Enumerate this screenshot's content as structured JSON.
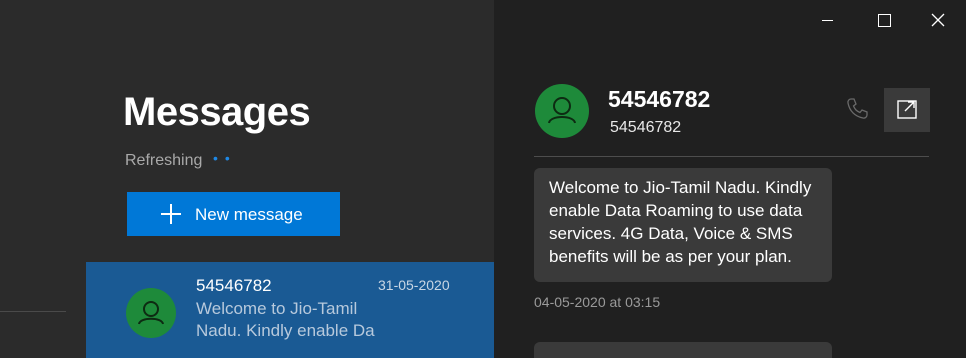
{
  "window": {
    "controls": [
      "minimize",
      "maximize",
      "close"
    ]
  },
  "sidebar": {
    "title": "Messages",
    "status": "Refreshing",
    "new_message_label": "New message",
    "conversations": [
      {
        "name": "54546782",
        "date": "31-05-2020",
        "preview": "Welcome to Jio-Tamil Nadu. Kindly enable Da",
        "selected": true
      }
    ]
  },
  "thread": {
    "contact_name": "54546782",
    "contact_number": "54546782",
    "messages": [
      {
        "text": "Welcome to Jio-Tamil Nadu. Kindly enable Data Roaming to use data services. 4G Data, Voice & SMS benefits will be as per your plan.",
        "timestamp": "04-05-2020 at 03:15"
      }
    ]
  },
  "colors": {
    "accent": "#0078d7",
    "selected_row": "#1a5a94",
    "avatar": "#1e8a3a",
    "sidebar_bg": "#2b2b2b",
    "thread_bg": "#202020"
  },
  "icons": {
    "new_message": "plus-icon",
    "avatar": "person-icon",
    "call": "phone-icon",
    "popout": "popout-icon"
  }
}
